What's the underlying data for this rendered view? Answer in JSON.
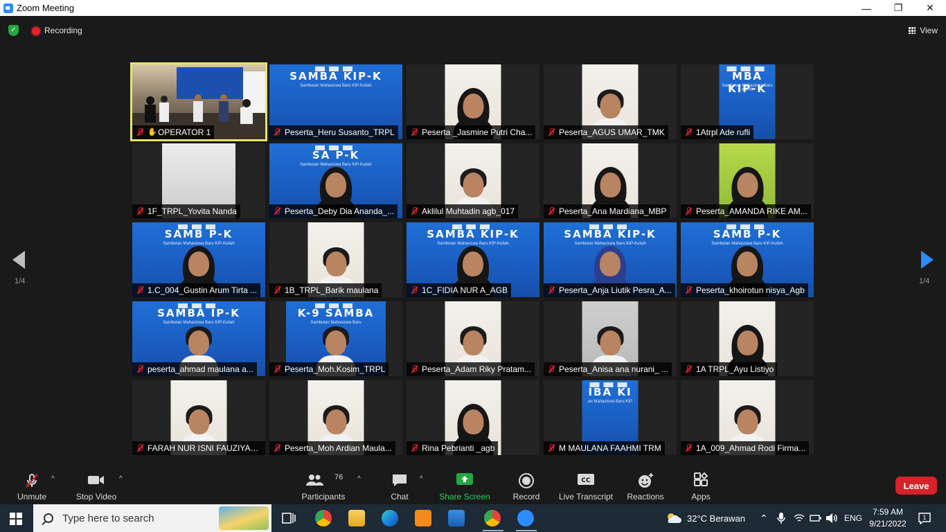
{
  "window": {
    "title": "Zoom Meeting",
    "controls": [
      "—",
      "❐",
      "✕"
    ]
  },
  "topbar": {
    "recording_label": "Recording",
    "view_label": "View"
  },
  "pager": {
    "left": "1/4",
    "right": "1/4"
  },
  "participants": [
    {
      "name": "OPERATOR 1",
      "bg": "stage",
      "active": true,
      "hand": true
    },
    {
      "name": "Peserta_Heru Susanto_TRPL",
      "bg": "blue",
      "banner": "SAMBA KIP-K",
      "sub": "Sambutan Mahasiswa Baru KIP-Kuliah"
    },
    {
      "name": "Peserta _Jasmine Putri Cha...",
      "bg": "wall",
      "person": "hijab"
    },
    {
      "name": "Peserta_AGUS UMAR_TMK",
      "bg": "wall",
      "person": "man"
    },
    {
      "name": "1Atrpl Ade rufli",
      "bg": "blue",
      "banner": "MBA KIP-K",
      "sub": "Sambutan Mahasiswa Baru KIP-K"
    },
    {
      "name": "1F_TRPL_Yovita Nanda",
      "bg": "room"
    },
    {
      "name": "Peserta_Deby Dia Ananda_...",
      "bg": "blue",
      "banner": "SA     P-K",
      "sub": "Sambutan Mahasiswa Baru KIP-Kuliah",
      "person": "hijab"
    },
    {
      "name": "Aklilul Muhtadin agb_017",
      "bg": "wall",
      "person": "man"
    },
    {
      "name": "Peserta_Ana Mardiana_MBP",
      "bg": "wall",
      "person": "hijab"
    },
    {
      "name": "Peserta_AMANDA RIKE AM...",
      "bg": "green",
      "person": "hijab"
    },
    {
      "name": "1.C_004_Gustin Arum Tirta ...",
      "bg": "blue",
      "banner": "SAMB     P-K",
      "sub": "Sambutan Mahasiswa Baru KIP-Kuliah",
      "person": "hijab"
    },
    {
      "name": "1B_TRPL_Barik maulana",
      "bg": "wall",
      "person": "man"
    },
    {
      "name": "1C_FIDIA NUR A_AGB",
      "bg": "blue",
      "banner": "SAMBA KIP-K",
      "sub": "Sambutan Mahasiswa Baru KIP-Kuliah",
      "person": "hijab"
    },
    {
      "name": "Peserta_Anja Liutik Pesra_A...",
      "bg": "blue",
      "banner": "SAMBA KIP-K",
      "sub": "Sambutan Mahasiswa Baru KIP-Kuliah",
      "person": "hijab-blue"
    },
    {
      "name": "Peserta_khoirotun nisya_Agb",
      "bg": "blue",
      "banner": "SAMB     P-K",
      "sub": "Sambutan Mahasiswa Baru KIP-Kuliah",
      "person": "hijab"
    },
    {
      "name": "peserta_ahmad maulana a...",
      "bg": "blue",
      "banner": "SAMBA  IP-K",
      "sub": "Sambutan Mahasiswa Baru KIP-Kuliah",
      "person": "man"
    },
    {
      "name": "Peserta_Moh.Kosim_TRPL",
      "bg": "blue",
      "banner": "K-9     SAMBA",
      "sub": "Sambutan Mahasiswa Baru",
      "person": "man"
    },
    {
      "name": "Peserta_Adam Riky Pratam...",
      "bg": "wall",
      "person": "man"
    },
    {
      "name": "Peserta_Anisa ana nurani_ ...",
      "bg": "gray",
      "person": "man"
    },
    {
      "name": "1A TRPL_Ayu Listiyo",
      "bg": "wall",
      "person": "hijab"
    },
    {
      "name": "FARAH NUR ISNI FAUZIYAH...",
      "bg": "wall",
      "person": "man"
    },
    {
      "name": "Peserta_Moh Ardian Maula...",
      "bg": "wall",
      "person": "man"
    },
    {
      "name": "Rina Pebrianti _agb",
      "bg": "wall",
      "person": "hijab"
    },
    {
      "name": "M MAULANA FAAHMI TRM",
      "bg": "blue",
      "banner": "IBA KI",
      "sub": "an Mahasiswa Baru KIP"
    },
    {
      "name": "1A_009_Ahmad Rodi Firma...",
      "bg": "wall",
      "person": "man"
    }
  ],
  "toolbar": {
    "unmute": "Unmute",
    "stop_video": "Stop Video",
    "participants": "Participants",
    "participants_count": "76",
    "chat": "Chat",
    "share_screen": "Share Screen",
    "record": "Record",
    "live_transcript": "Live Transcript",
    "reactions": "Reactions",
    "apps": "Apps",
    "leave": "Leave",
    "cc_icon": "CC"
  },
  "taskbar": {
    "search_placeholder": "Type here to search",
    "weather": "32°C  Berawan",
    "lang": "ENG",
    "time": "7:59 AM",
    "date": "9/21/2022",
    "notifications": "1"
  },
  "colors": {
    "accent": "#2d8cff",
    "leave": "#d6232a",
    "share": "#23a843",
    "active_border": "#e6e36b",
    "muted": "#e0242c"
  }
}
